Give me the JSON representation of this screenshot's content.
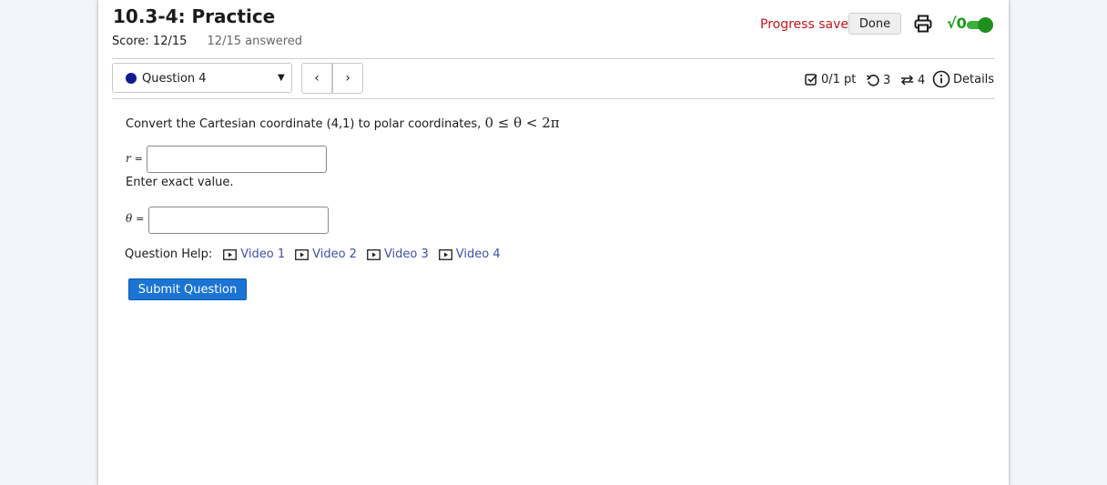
{
  "header": {
    "title": "10.3-4: Practice",
    "score": "Score: 12/15",
    "answered": "12/15 answered",
    "progress_status": "Progress saved",
    "done_label": "Done",
    "math_toggle_label": "√0"
  },
  "nav": {
    "question_label": "Question 4",
    "prev_symbol": "‹",
    "next_symbol": "›"
  },
  "meta": {
    "points": "0/1 pt",
    "retries": "3",
    "attempts": "4",
    "details_label": "Details"
  },
  "question": {
    "prompt": "Convert the Cartesian coordinate (4,1) to polar coordinates,",
    "constraint": "0 ≤ θ < 2π",
    "r_label": "r",
    "theta_label": "θ",
    "equals": "=",
    "r_value": "",
    "theta_value": "",
    "hint": "Enter exact value."
  },
  "help": {
    "label": "Question Help:",
    "videos": [
      "Video 1",
      "Video 2",
      "Video 3",
      "Video 4"
    ]
  },
  "submit_label": "Submit Question",
  "colors": {
    "progress_red": "#c0161b",
    "toggle_green": "#1f8f1f",
    "question_dot": "#121a8f",
    "link_blue": "#4150a5",
    "submit_blue": "#1b74d4"
  },
  "icons": [
    "print-icon",
    "checkbox-icon",
    "retry-icon",
    "attempts-icon",
    "info-icon",
    "play-icon",
    "chevron-down-icon"
  ]
}
